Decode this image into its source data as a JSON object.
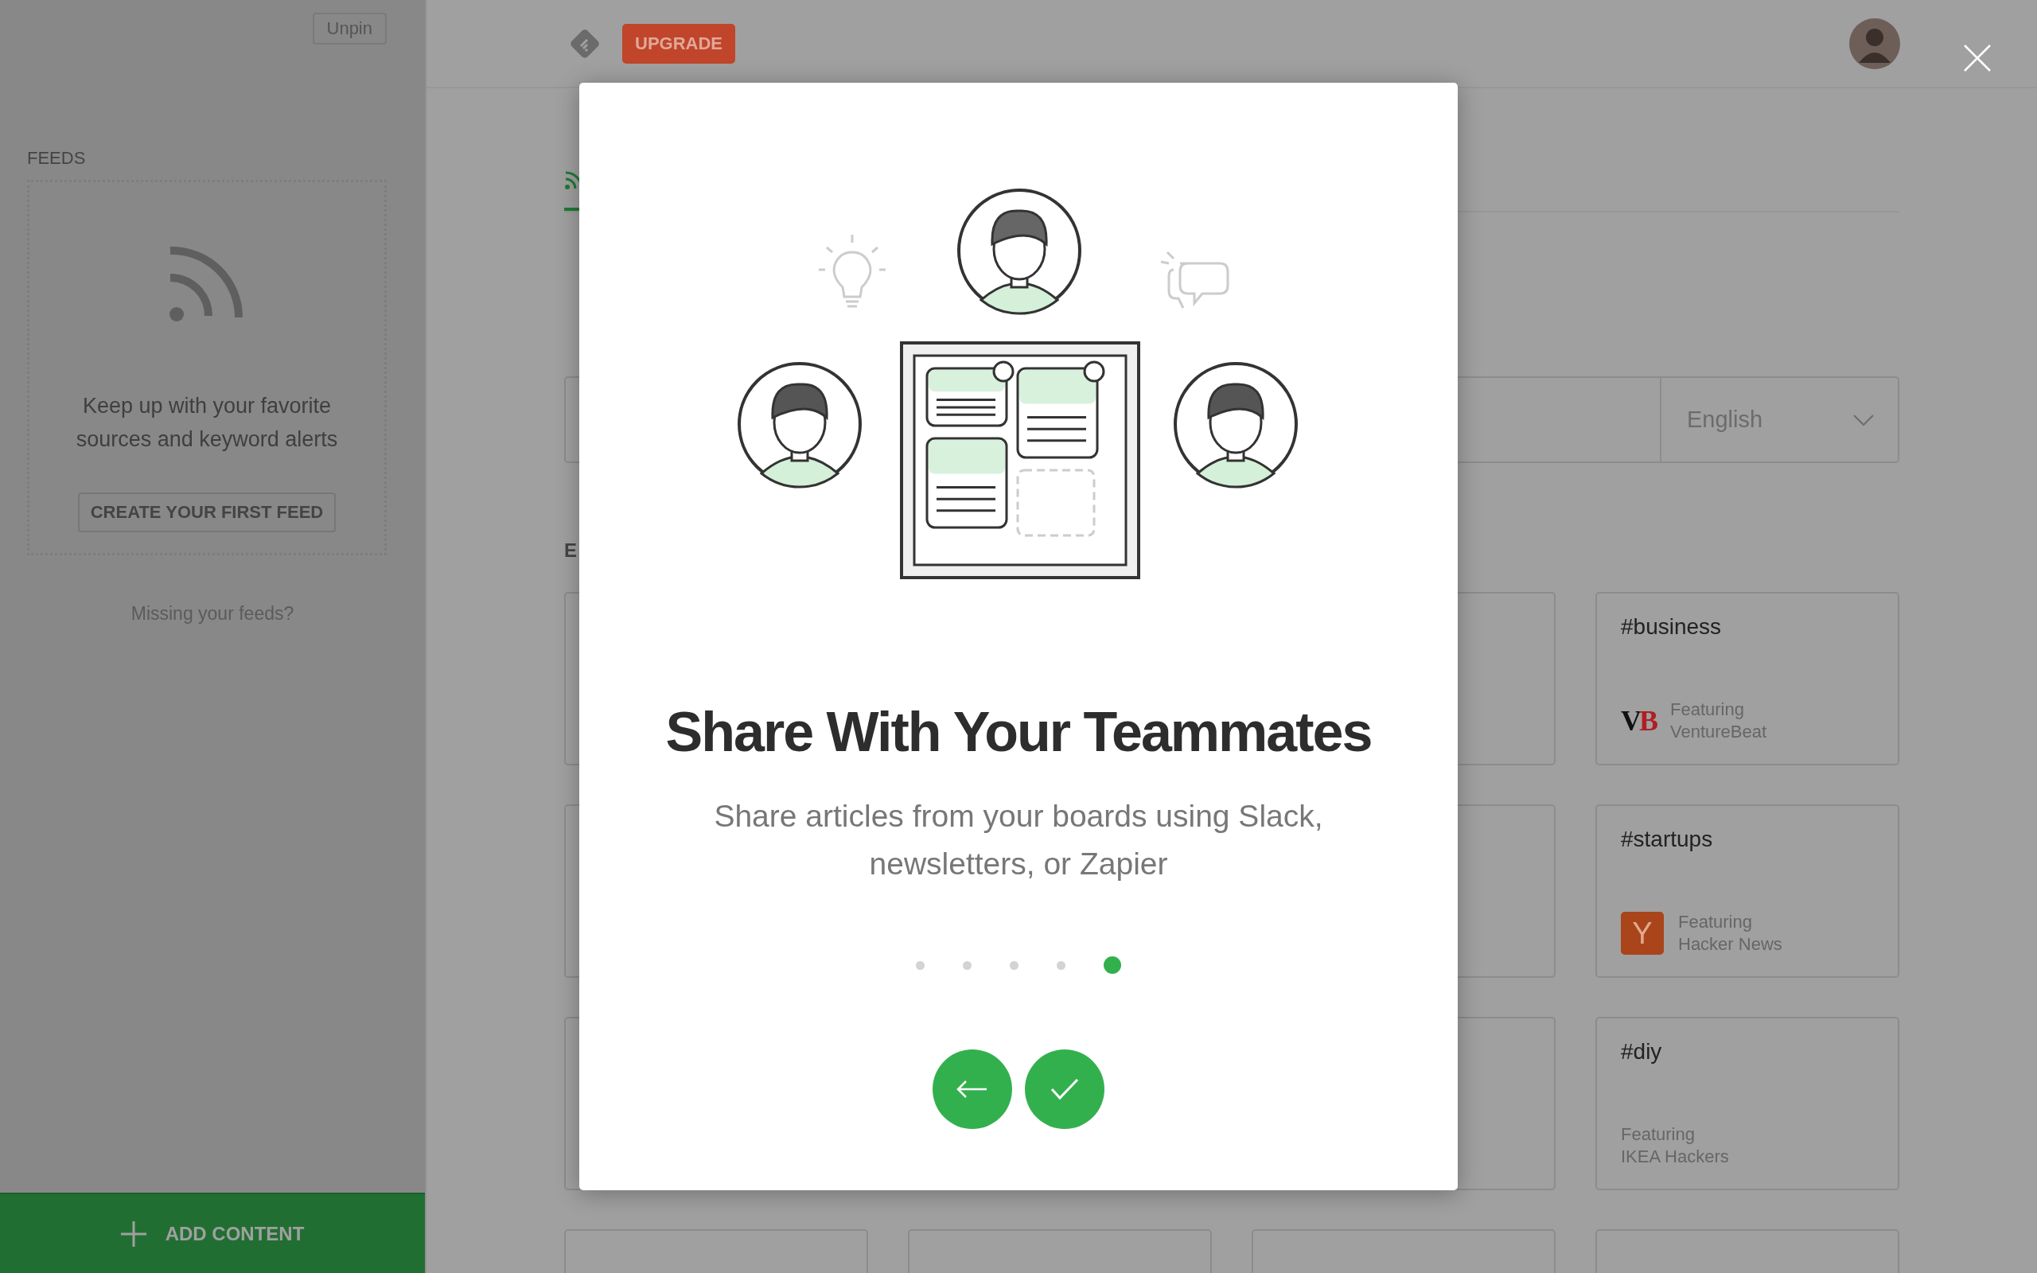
{
  "sidebar": {
    "unpin_button": "Unpin",
    "section_label": "FEEDS",
    "empty_state": {
      "message": "Keep up with your favorite sources and keyword alerts",
      "button": "CREATE YOUR FIRST FEED"
    },
    "missing_link": "Missing your feeds?",
    "add_content_button": "ADD CONTENT"
  },
  "top_bar": {
    "upgrade_button": "UPGRADE"
  },
  "main": {
    "section_fragment": "E",
    "language_select": "English",
    "cards": [
      {
        "kind": "covered"
      },
      {
        "kind": "covered"
      },
      {
        "kind": "topic",
        "topic": "#business",
        "featuring": "Featuring",
        "source": "VentureBeat",
        "logo": {
          "kind": "wordmark",
          "text": "VB"
        }
      },
      {
        "kind": "covered"
      },
      {
        "kind": "covered"
      },
      {
        "kind": "topic",
        "topic": "#startups",
        "featuring": "Featuring",
        "source": "Hacker News",
        "logo": {
          "kind": "tile",
          "text": "Y"
        }
      },
      {
        "kind": "covered"
      },
      {
        "kind": "covered"
      },
      {
        "kind": "topic",
        "topic": "#diy",
        "featuring": "Featuring",
        "source": "IKEA Hackers"
      },
      {
        "kind": "covered"
      },
      {
        "kind": "covered"
      },
      {
        "kind": "covered"
      },
      {
        "kind": "covered"
      }
    ]
  },
  "modal": {
    "title": "Share With Your Teammates",
    "description": "Share articles from your boards using Slack, newsletters, or Zapier",
    "steps": [
      {
        "selected": false
      },
      {
        "selected": false
      },
      {
        "selected": false
      },
      {
        "selected": false
      },
      {
        "selected": true
      }
    ],
    "buttons": [
      {
        "kind": "back"
      },
      {
        "kind": "done"
      }
    ]
  }
}
